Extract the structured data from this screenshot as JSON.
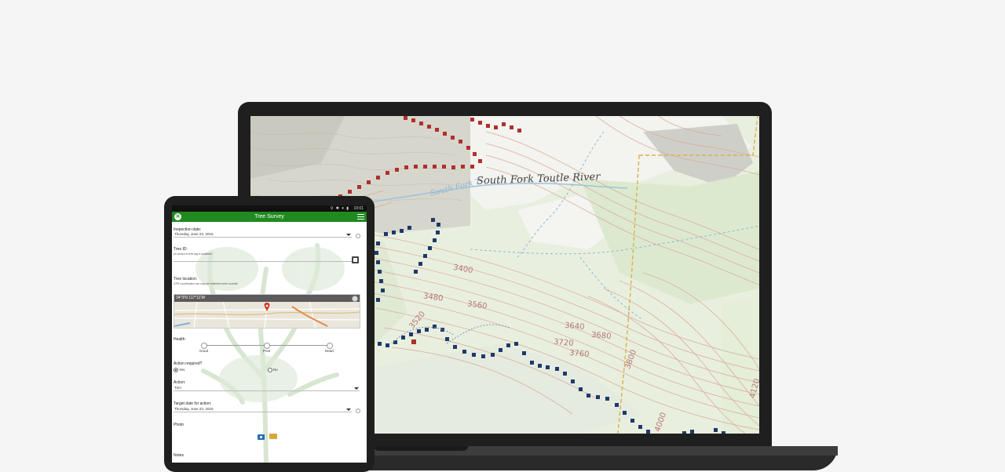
{
  "map": {
    "river_label": "South Fork Toutle River",
    "river_label_secondary": "South Fork T",
    "contour_labels": [
      "3400",
      "3480",
      "3520",
      "3560",
      "3640",
      "3680",
      "3720",
      "3760",
      "3800",
      "4000",
      "4120"
    ]
  },
  "form_app": {
    "status_time": "10:01",
    "status_icons": "⚲ ✱ ▾ ▮",
    "title": "Tree Survey",
    "inspection_date": {
      "label": "Inspection date:",
      "value": "Thursday, June 23, 2016"
    },
    "tree_id": {
      "label": "Tree ID:",
      "hint": "as shown in tree tag if available",
      "value": ""
    },
    "tree_location": {
      "label": "Tree location:",
      "hint": "GPS coordinates can only be collected when outside",
      "coords": "34°3'N 117°11'W"
    },
    "health": {
      "label": "Health:",
      "options": [
        "Good",
        "Poor",
        "Dead"
      ]
    },
    "action_required": {
      "label": "Action required?",
      "options": [
        "Yes",
        "No"
      ],
      "selected": "Yes"
    },
    "action": {
      "label": "Action:",
      "value": "Trim"
    },
    "target_date": {
      "label": "Target date for action:",
      "value": "Thursday, June 23, 2016"
    },
    "photo": {
      "label": "Photo"
    },
    "notes": {
      "label": "Notes"
    }
  },
  "colors": {
    "app_green": "#1f8a1f",
    "track_red": "#b0302a",
    "track_blue": "#1e3a6b",
    "contour": "#d9a899"
  }
}
